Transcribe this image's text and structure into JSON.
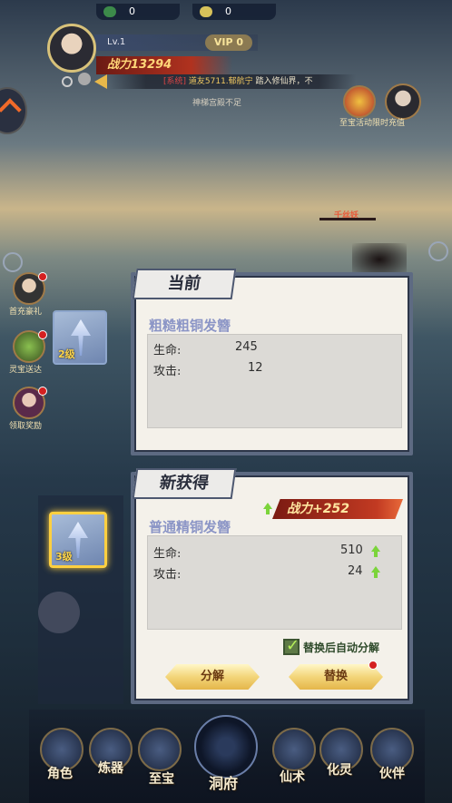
{
  "resources": {
    "res1_value": "0",
    "res2_value": "0"
  },
  "player": {
    "level": "Lv.1",
    "vip": "VIP 0",
    "power": "战力13294"
  },
  "notice": {
    "tag": "[系统]",
    "highlight": "道友5711.郁航宁",
    "text": "踏入修仙界，不",
    "line2": "神梯宫殿不足"
  },
  "side": {
    "right_label": "至宝活动限时充值",
    "items": [
      {
        "label": "首充豪礼"
      },
      {
        "label": "灵宝送达"
      },
      {
        "label": "领取奖励"
      }
    ],
    "boss_label": "千丝妖"
  },
  "current_panel": {
    "tab": "当前",
    "item_name": "粗糙粗铜发簪",
    "slot_level": "2级",
    "stats": [
      {
        "label": "生命:",
        "value": "245"
      },
      {
        "label": "攻击:",
        "value": "12"
      }
    ]
  },
  "new_panel": {
    "tab": "新获得",
    "item_name": "普通精铜发簪",
    "slot_level": "3级",
    "power_delta": "战力+252",
    "stats": [
      {
        "label": "生命:",
        "value": "510"
      },
      {
        "label": "攻击:",
        "value": "24"
      }
    ],
    "auto_decompose_label": "替换后自动分解",
    "auto_decompose_checked": true,
    "decompose_button": "分解",
    "replace_button": "替换"
  },
  "bottom_nav": [
    {
      "label": "角色",
      "icon": "character-icon"
    },
    {
      "label": "炼器",
      "icon": "forge-icon"
    },
    {
      "label": "至宝",
      "icon": "treasure-icon"
    },
    {
      "label": "洞府",
      "icon": "cave-icon"
    },
    {
      "label": "仙术",
      "icon": "spell-icon"
    },
    {
      "label": "化灵",
      "icon": "spirit-icon"
    },
    {
      "label": "伙伴",
      "icon": "companion-icon"
    }
  ],
  "colors": {
    "power_red": "#b0321f",
    "gold": "#f3d57a",
    "green_arrow": "#7bd43a",
    "item_name": "#8b95c6"
  }
}
